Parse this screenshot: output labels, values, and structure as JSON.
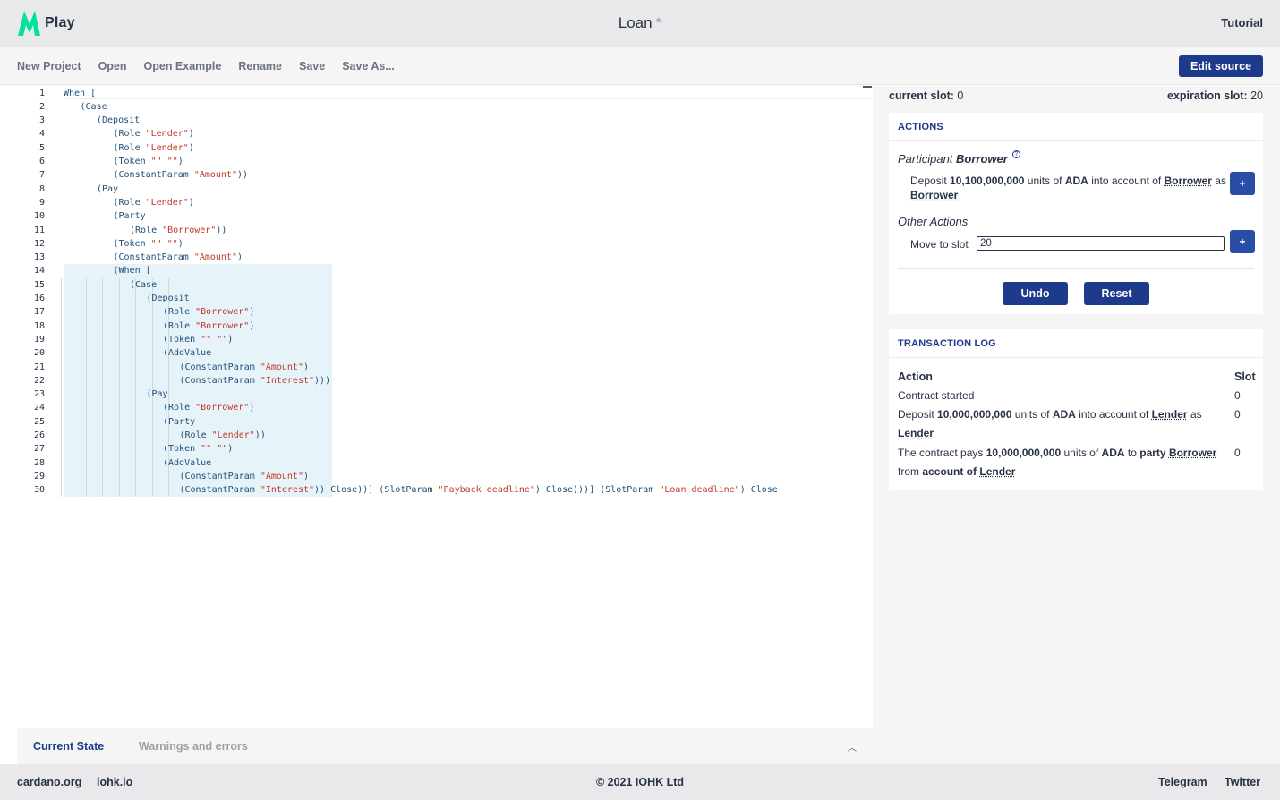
{
  "header": {
    "logo_text": "Play",
    "title": "Loan",
    "unsaved_marker": "*",
    "tutorial_label": "Tutorial"
  },
  "menu": {
    "items": [
      "New Project",
      "Open",
      "Open Example",
      "Rename",
      "Save",
      "Save As..."
    ],
    "edit_source_label": "Edit source"
  },
  "editor": {
    "lines": [
      {
        "n": "1",
        "indent": 0,
        "text": "When ["
      },
      {
        "n": "2",
        "indent": 1,
        "text": "(Case"
      },
      {
        "n": "3",
        "indent": 2,
        "text": "(Deposit"
      },
      {
        "n": "4",
        "indent": 3,
        "text": "(Role \"Lender\")"
      },
      {
        "n": "5",
        "indent": 3,
        "text": "(Role \"Lender\")"
      },
      {
        "n": "6",
        "indent": 3,
        "text": "(Token \"\" \"\")"
      },
      {
        "n": "7",
        "indent": 3,
        "text": "(ConstantParam \"Amount\"))"
      },
      {
        "n": "8",
        "indent": 2,
        "text": "(Pay"
      },
      {
        "n": "9",
        "indent": 3,
        "text": "(Role \"Lender\")"
      },
      {
        "n": "10",
        "indent": 3,
        "text": "(Party"
      },
      {
        "n": "11",
        "indent": 4,
        "text": "(Role \"Borrower\"))"
      },
      {
        "n": "12",
        "indent": 3,
        "text": "(Token \"\" \"\")"
      },
      {
        "n": "13",
        "indent": 3,
        "text": "(ConstantParam \"Amount\")"
      },
      {
        "n": "14",
        "indent": 3,
        "text": "(When ["
      },
      {
        "n": "15",
        "indent": 4,
        "text": "(Case"
      },
      {
        "n": "16",
        "indent": 5,
        "text": "(Deposit"
      },
      {
        "n": "17",
        "indent": 6,
        "text": "(Role \"Borrower\")"
      },
      {
        "n": "18",
        "indent": 6,
        "text": "(Role \"Borrower\")"
      },
      {
        "n": "19",
        "indent": 6,
        "text": "(Token \"\" \"\")"
      },
      {
        "n": "20",
        "indent": 6,
        "text": "(AddValue"
      },
      {
        "n": "21",
        "indent": 7,
        "text": "(ConstantParam \"Amount\")"
      },
      {
        "n": "22",
        "indent": 7,
        "text": "(ConstantParam \"Interest\")))"
      },
      {
        "n": "23",
        "indent": 5,
        "text": "(Pay"
      },
      {
        "n": "24",
        "indent": 6,
        "text": "(Role \"Borrower\")"
      },
      {
        "n": "25",
        "indent": 6,
        "text": "(Party"
      },
      {
        "n": "26",
        "indent": 7,
        "text": "(Role \"Lender\"))"
      },
      {
        "n": "27",
        "indent": 6,
        "text": "(Token \"\" \"\")"
      },
      {
        "n": "28",
        "indent": 6,
        "text": "(AddValue"
      },
      {
        "n": "29",
        "indent": 7,
        "text": "(ConstantParam \"Amount\")"
      },
      {
        "n": "30",
        "indent": 7,
        "text": "(ConstantParam \"Interest\")) Close))] (SlotParam \"Payback deadline\") Close)))] (SlotParam \"Loan deadline\") Close"
      }
    ]
  },
  "bottom_tabs": {
    "current_state": "Current State",
    "warnings": "Warnings and errors"
  },
  "simulation": {
    "current_slot_label": "current slot:",
    "current_slot_value": "0",
    "expiration_slot_label": "expiration slot:",
    "expiration_slot_value": "20",
    "actions_heading": "ACTIONS",
    "participant_prefix": "Participant",
    "participant_name": "Borrower",
    "deposit": {
      "t1": "Deposit",
      "amount": "10,100,000,000",
      "t2": "units of",
      "token": "ADA",
      "t3": "into account of",
      "account": "Borrower",
      "t4": "as",
      "party": "Borrower",
      "button": "+"
    },
    "other_actions_label": "Other Actions",
    "move_to_slot_label": "Move to slot",
    "move_to_slot_value": "20",
    "move_button": "+",
    "undo_label": "Undo",
    "reset_label": "Reset",
    "log_heading": "TRANSACTION LOG",
    "log_header_action": "Action",
    "log_header_slot": "Slot",
    "log": {
      "r1": {
        "text": "Contract started",
        "slot": "0"
      },
      "r2": {
        "t1": "Deposit",
        "amount": "10,000,000,000",
        "t2": "units of",
        "token": "ADA",
        "t3": "into account of",
        "account": "Lender",
        "t4": "as",
        "party": "Lender",
        "slot": "0"
      },
      "r3": {
        "t1": "The contract pays",
        "amount": "10,000,000,000",
        "t2": "units of",
        "token": "ADA",
        "t3": "to",
        "t_party": "party",
        "party": "Borrower",
        "t4": "from",
        "t_account": "account of",
        "account": "Lender",
        "slot": "0"
      }
    }
  },
  "footer": {
    "cardano": "cardano.org",
    "iohk": "iohk.io",
    "copyright": "© 2021 IOHK Ltd",
    "telegram": "Telegram",
    "twitter": "Twitter"
  },
  "colors": {
    "brand_green": "#00e39c",
    "primary_blue": "#1e3a8a",
    "string_red": "#c0392b",
    "highlight": "#e6f3f8"
  }
}
